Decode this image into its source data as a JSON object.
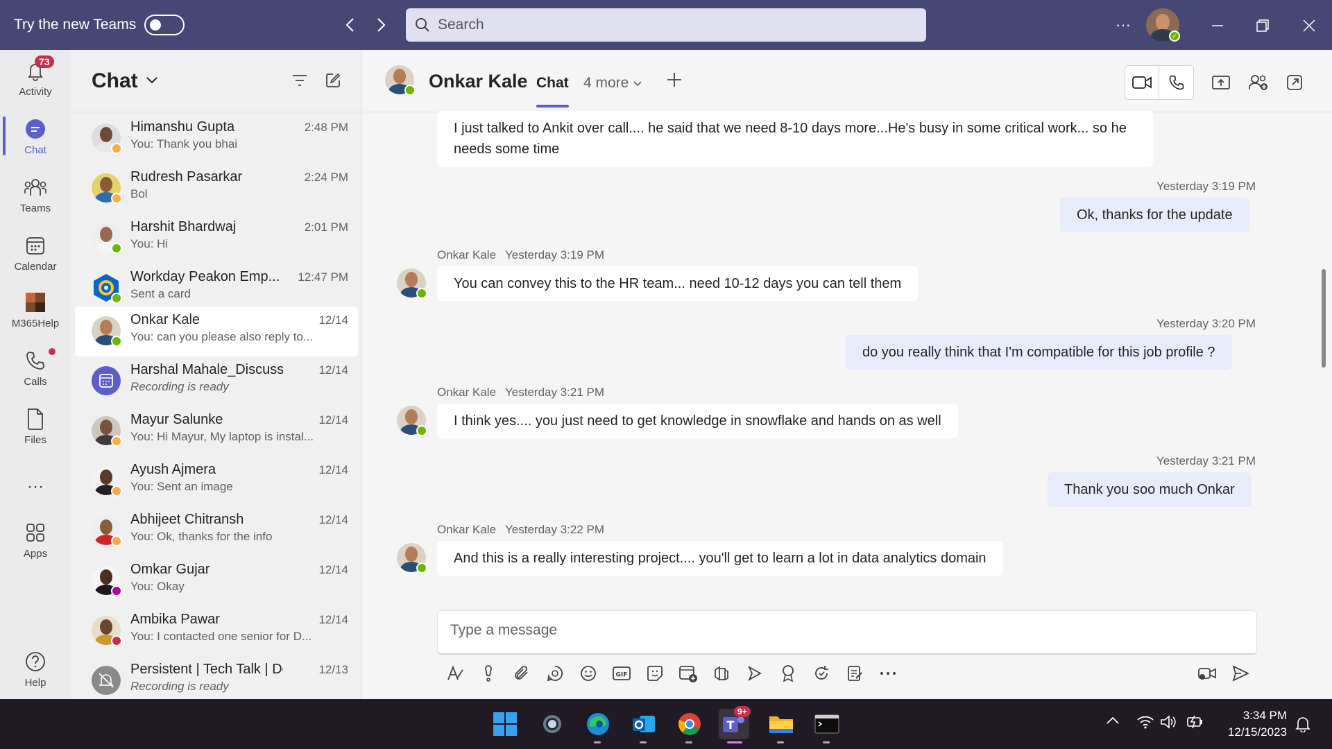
{
  "titlebar": {
    "try_teams_label": "Try the new Teams",
    "search_placeholder": "Search",
    "more_label": "···"
  },
  "rail": {
    "items": [
      {
        "label": "Activity",
        "badge": "73"
      },
      {
        "label": "Chat"
      },
      {
        "label": "Teams"
      },
      {
        "label": "Calendar"
      },
      {
        "label": "M365Help"
      },
      {
        "label": "Calls"
      },
      {
        "label": "Files"
      },
      {
        "label": "···"
      },
      {
        "label": "Apps"
      },
      {
        "label": "Help"
      }
    ]
  },
  "chatlist": {
    "title": "Chat",
    "items": [
      {
        "name": "Himanshu Gupta",
        "preview": "You: Thank you bhai",
        "time": "2:48 PM",
        "status": "away"
      },
      {
        "name": "Rudresh Pasarkar",
        "preview": "Bol",
        "time": "2:24 PM",
        "status": "away"
      },
      {
        "name": "Harshit Bhardwaj",
        "preview": "You: Hi",
        "time": "2:01 PM",
        "status": "available"
      },
      {
        "name": "Workday Peakon Emp...",
        "preview": "Sent a card",
        "time": "12:47 PM",
        "status": "available"
      },
      {
        "name": "Onkar Kale",
        "preview": "You: can you please also reply to...",
        "time": "12/14",
        "status": "available"
      },
      {
        "name": "Harshal Mahale_Discussi...",
        "preview": "Recording is ready",
        "time": "12/14",
        "status": "none"
      },
      {
        "name": "Mayur Salunke",
        "preview": "You: Hi Mayur, My laptop is instal...",
        "time": "12/14",
        "status": "away"
      },
      {
        "name": "Ayush Ajmera",
        "preview": "You: Sent an image",
        "time": "12/14",
        "status": "away"
      },
      {
        "name": "Abhijeet Chitransh",
        "preview": "You: Ok, thanks for the info",
        "time": "12/14",
        "status": "away"
      },
      {
        "name": "Omkar Gujar",
        "preview": "You: Okay",
        "time": "12/14",
        "status": "ooo"
      },
      {
        "name": "Ambika Pawar",
        "preview": "You: I contacted one senior for D...",
        "time": "12/14",
        "status": "dnd"
      },
      {
        "name": "Persistent | Tech Talk | De...",
        "preview": "Recording is ready",
        "time": "12/13",
        "status": "none"
      }
    ]
  },
  "header": {
    "name": "Onkar Kale",
    "tab_chat": "Chat",
    "tab_more": "4 more"
  },
  "messages": [
    {
      "text": "I just talked to Ankit over call.... he said that we need 8-10 days more...He's busy in some critical work... so he needs some time",
      "dir": "in"
    },
    {
      "meta": "Yesterday 3:19 PM",
      "text": "Ok, thanks for the update",
      "dir": "out"
    },
    {
      "sender": "Onkar Kale",
      "meta": "Yesterday 3:19 PM",
      "text": "You can convey this to the HR team... need 10-12 days you can tell them",
      "dir": "in"
    },
    {
      "meta": "Yesterday 3:20 PM",
      "text": "do you really think that I'm compatible for this job profile ?",
      "dir": "out"
    },
    {
      "sender": "Onkar Kale",
      "meta": "Yesterday 3:21 PM",
      "text": "I think yes.... you just need to get knowledge in snowflake and hands on as well",
      "dir": "in"
    },
    {
      "meta": "Yesterday 3:21 PM",
      "text": "Thank you soo much Onkar",
      "dir": "out"
    },
    {
      "sender": "Onkar Kale",
      "meta": "Yesterday 3:22 PM",
      "text": "And this is a really interesting project.... you'll get to learn a lot in data analytics domain",
      "dir": "in"
    }
  ],
  "compose": {
    "placeholder": "Type a message"
  },
  "taskbar": {
    "time": "3:34 PM",
    "date": "12/15/2023",
    "teams_badge": "9+"
  },
  "colors": {
    "titlebar": "#464775",
    "accent": "#5b5fc7",
    "badge": "#c4314b",
    "outgoing_bubble": "#e8ebfa"
  }
}
